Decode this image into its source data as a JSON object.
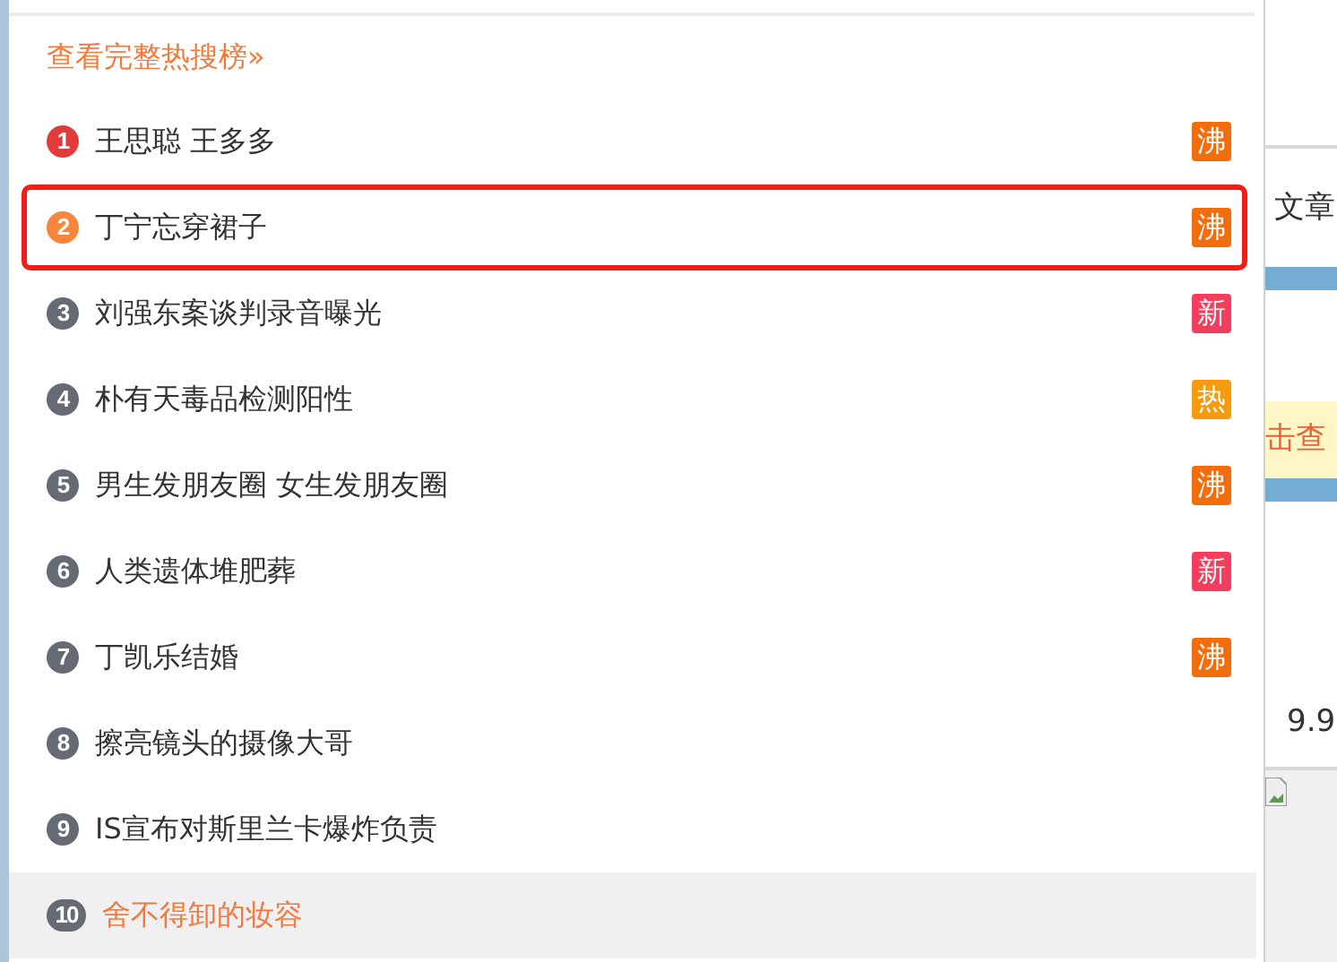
{
  "hot_search_panel": {
    "full_list_link": "查看完整热搜榜»",
    "items": [
      {
        "rank": "1",
        "title": "王思聪 王多多",
        "color": "#e03c3c",
        "badge": {
          "text": "沸",
          "kind": "boiling"
        },
        "highlighted": false,
        "hovered": false
      },
      {
        "rank": "2",
        "title": "丁宁忘穿裙子",
        "color": "#f7853c",
        "badge": {
          "text": "沸",
          "kind": "boiling"
        },
        "highlighted": true,
        "hovered": false
      },
      {
        "rank": "3",
        "title": "刘强东案谈判录音曝光",
        "color": "#666a73",
        "badge": {
          "text": "新",
          "kind": "new"
        },
        "highlighted": false,
        "hovered": false
      },
      {
        "rank": "4",
        "title": "朴有天毒品检测阳性",
        "color": "#666a73",
        "badge": {
          "text": "热",
          "kind": "hot"
        },
        "highlighted": false,
        "hovered": false
      },
      {
        "rank": "5",
        "title": "男生发朋友圈 女生发朋友圈",
        "color": "#666a73",
        "badge": {
          "text": "沸",
          "kind": "boiling"
        },
        "highlighted": false,
        "hovered": false
      },
      {
        "rank": "6",
        "title": "人类遗体堆肥葬",
        "color": "#666a73",
        "badge": {
          "text": "新",
          "kind": "new"
        },
        "highlighted": false,
        "hovered": false
      },
      {
        "rank": "7",
        "title": "丁凯乐结婚",
        "color": "#666a73",
        "badge": {
          "text": "沸",
          "kind": "boiling"
        },
        "highlighted": false,
        "hovered": false
      },
      {
        "rank": "8",
        "title": "擦亮镜头的摄像大哥",
        "color": "#666a73",
        "highlighted": false,
        "hovered": false
      },
      {
        "rank": "9",
        "title": "IS宣布对斯里兰卡爆炸负责",
        "color": "#666a73",
        "highlighted": false,
        "hovered": false
      },
      {
        "rank": "10",
        "title": "舍不得卸的妆容",
        "color": "#666a73",
        "highlighted": false,
        "hovered": true
      }
    ]
  },
  "background_page": {
    "text_1": "文章",
    "banner_text": "击查",
    "price": "9.9"
  }
}
